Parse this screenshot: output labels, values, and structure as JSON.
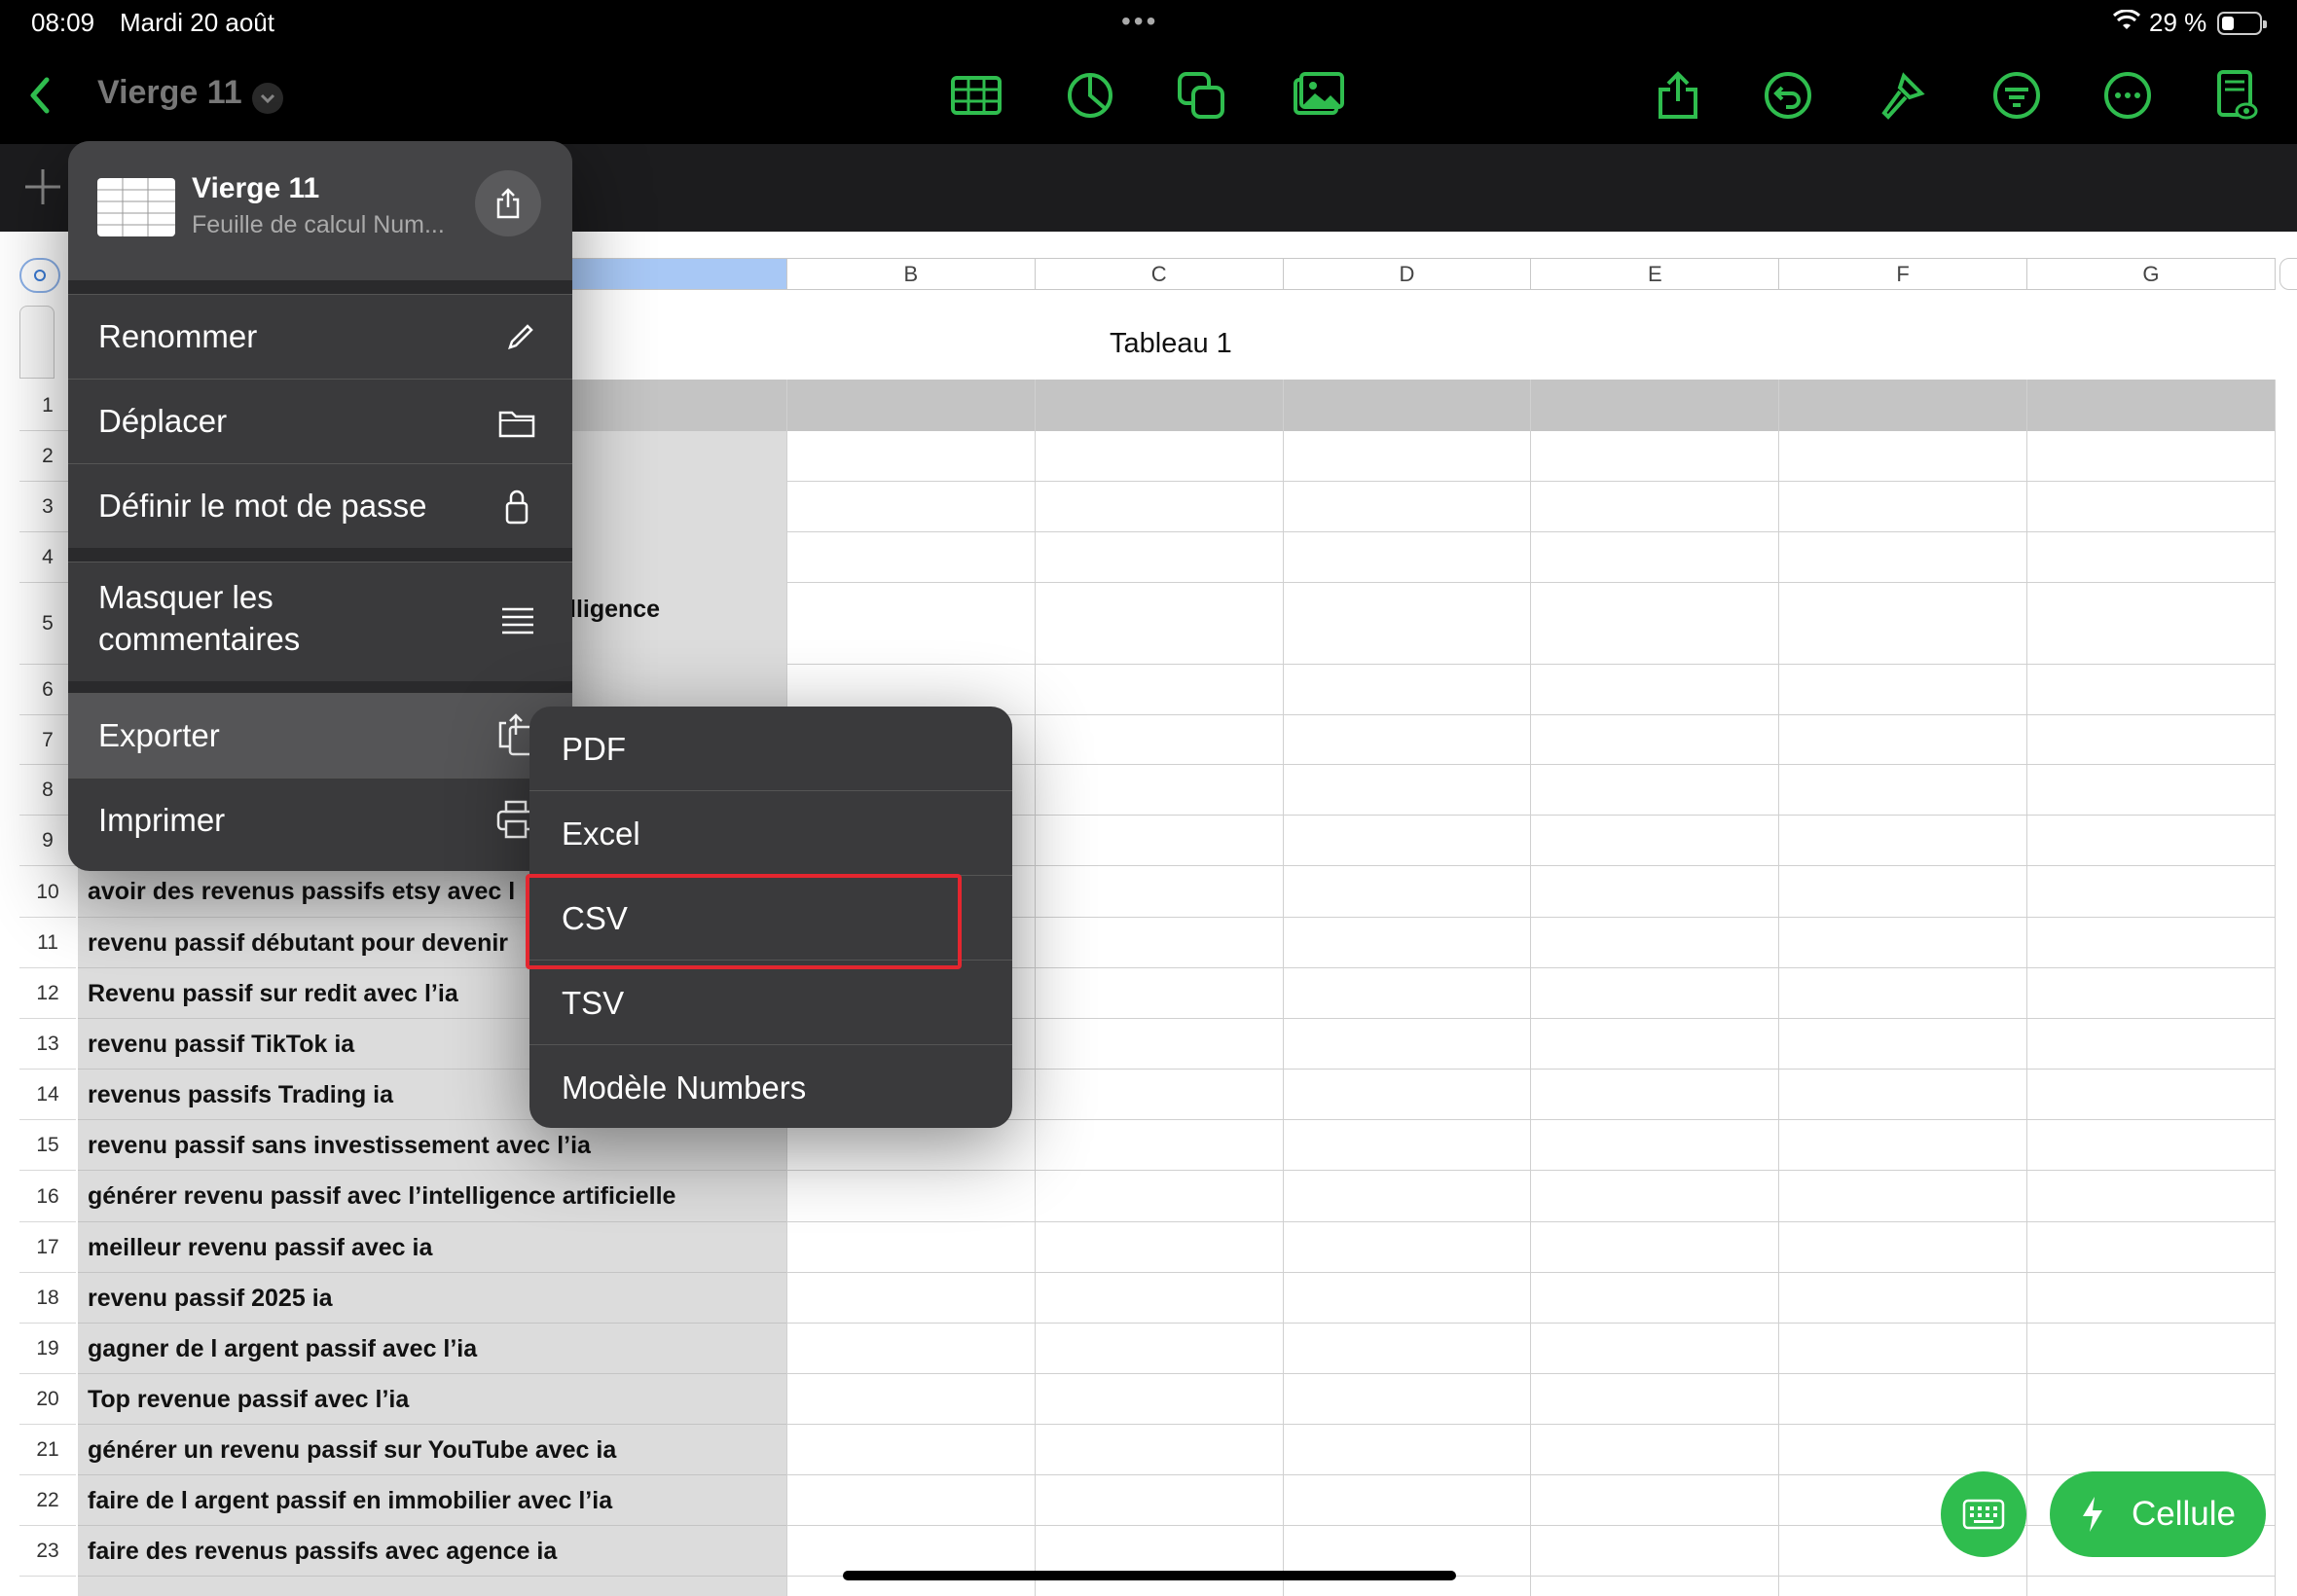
{
  "status_bar": {
    "time": "08:09",
    "date": "Mardi 20 août",
    "battery": "29 %"
  },
  "toolbar": {
    "doc_title": "Vierge 11",
    "icons": [
      "back-chevron-icon",
      "title-chevron-icon",
      "table-icon",
      "chart-icon",
      "shapes-icon",
      "media-icon",
      "share-icon",
      "undo-icon",
      "format-brush-icon",
      "organize-icon",
      "more-icon",
      "document-view-icon"
    ]
  },
  "sheet": {
    "table_title": "Tableau 1",
    "columns": [
      "B",
      "C",
      "D",
      "E",
      "F",
      "G"
    ],
    "row_numbers": [
      "1",
      "2",
      "3",
      "4",
      "5",
      "6",
      "7",
      "8",
      "9",
      "10",
      "11",
      "12",
      "13",
      "14",
      "15",
      "16",
      "17",
      "18",
      "19",
      "20",
      "21",
      "22",
      "23"
    ],
    "partial_row5_text": "lligence",
    "cells": [
      {
        "row": "10",
        "text": "avoir des revenus passifs etsy avec l"
      },
      {
        "row": "11",
        "text": "revenu passif débutant pour devenir"
      },
      {
        "row": "12",
        "text": "Revenu passif sur redit avec l’ia"
      },
      {
        "row": "13",
        "text": "revenu passif TikTok ia"
      },
      {
        "row": "14",
        "text": "revenus passifs Trading ia"
      },
      {
        "row": "15",
        "text": "revenu passif sans investissement avec l’ia"
      },
      {
        "row": "16",
        "text": "générer revenu passif avec l’intelligence artificielle"
      },
      {
        "row": "17",
        "text": "meilleur revenu passif avec ia"
      },
      {
        "row": "18",
        "text": "revenu passif 2025 ia"
      },
      {
        "row": "19",
        "text": "gagner de l argent passif avec l’ia"
      },
      {
        "row": "20",
        "text": "Top revenue passif avec l’ia"
      },
      {
        "row": "21",
        "text": "générer un revenu passif sur YouTube avec ia"
      },
      {
        "row": "22",
        "text": "faire de l argent passif en immobilier avec l’ia"
      },
      {
        "row": "23",
        "text": "faire des revenus passifs avec agence ia"
      }
    ]
  },
  "popover": {
    "title": "Vierge 11",
    "subtitle": "Feuille de calcul Num...",
    "items": [
      {
        "label": "Renommer",
        "icon": "pencil-icon"
      },
      {
        "label": "Déplacer",
        "icon": "folder-icon"
      },
      {
        "label": "Définir le mot de passe",
        "icon": "lock-icon"
      },
      {
        "label_line1": "Masquer les",
        "label_line2": "commentaires",
        "icon": "comments-icon"
      },
      {
        "label": "Exporter",
        "icon": "export-icon"
      },
      {
        "label": "Imprimer",
        "icon": "printer-icon"
      }
    ]
  },
  "export_submenu": {
    "items": [
      "PDF",
      "Excel",
      "CSV",
      "TSV",
      "Modèle Numbers"
    ],
    "highlighted": "CSV"
  },
  "bottom": {
    "cell_button": "Cellule"
  },
  "colors": {
    "accent": "#2fbd4e",
    "highlight": "#e4262f"
  }
}
